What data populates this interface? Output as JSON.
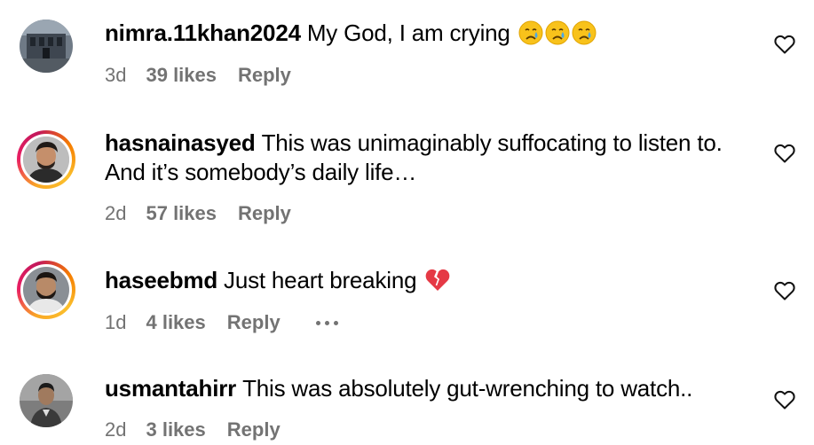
{
  "comments": [
    {
      "username": "nimra.11khan2024",
      "text": "My God, I am crying",
      "emojis": [
        "crying-face",
        "crying-face",
        "crying-face"
      ],
      "time": "3d",
      "likes": "39 likes",
      "reply": "Reply"
    },
    {
      "username": "hasnainasyed",
      "text": "This was unimaginably suffocating to listen to.",
      "text_line2": "And it’s somebody’s daily life…",
      "time": "2d",
      "likes": "57 likes",
      "reply": "Reply"
    },
    {
      "username": "haseebmd",
      "text": "Just heart breaking",
      "emojis": [
        "broken-heart"
      ],
      "time": "1d",
      "likes": "4 likes",
      "reply": "Reply"
    },
    {
      "username": "usmantahirr",
      "text": "This was absolutely gut-wrenching to watch..",
      "time": "2d",
      "likes": "3 likes",
      "reply": "Reply"
    }
  ],
  "colors": {
    "meta_text": "#737373",
    "story_ring": [
      "#f9a825",
      "#e91e63",
      "#f57c00"
    ]
  }
}
